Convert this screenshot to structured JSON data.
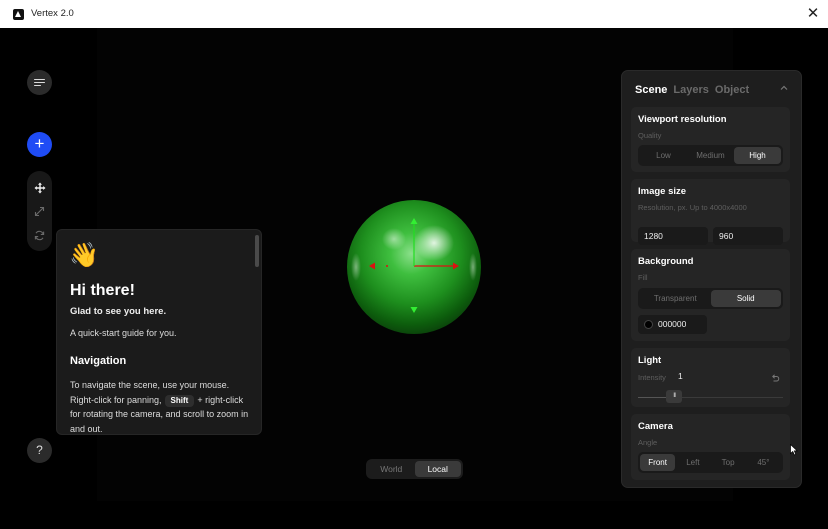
{
  "window": {
    "title": "Vertex 2.0",
    "close_glyph": "✕"
  },
  "toolbar": {
    "add_glyph": "+",
    "help_glyph": "?",
    "icons": [
      "menu-icon",
      "plus-icon",
      "move-icon",
      "scale-icon",
      "rotate-icon",
      "help-icon"
    ]
  },
  "welcome": {
    "emoji": "👋",
    "title": "Hi there!",
    "subtitle": "Glad to see you here.",
    "guide": "A quick-start guide for you.",
    "nav_heading": "Navigation",
    "nav_text_1": "To navigate the scene, use your mouse. Right-click for panning,",
    "nav_key": "Shift",
    "nav_text_2": "+ right-click for rotating the camera, and scroll to zoom in and out."
  },
  "viewport": {
    "sphere_color": "#2fae2f",
    "space_toggle": {
      "options": [
        "World",
        "Local"
      ],
      "selected": "Local"
    }
  },
  "panel": {
    "tabs": [
      {
        "label": "Scene",
        "active": true
      },
      {
        "label": "Layers",
        "active": false
      },
      {
        "label": "Object",
        "active": false
      }
    ],
    "viewport_resolution": {
      "title": "Viewport resolution",
      "quality_label": "Quality",
      "options": [
        "Low",
        "Medium",
        "High"
      ],
      "selected": "High"
    },
    "image_size": {
      "title": "Image size",
      "hint": "Resolution, px. Up to 4000x4000",
      "width": "1280",
      "height": "960"
    },
    "background": {
      "title": "Background",
      "fill_label": "Fill",
      "options": [
        "Transparent",
        "Solid"
      ],
      "selected": "Solid",
      "color": "000000"
    },
    "light": {
      "title": "Light",
      "intensity_label": "Intensity",
      "intensity": "1",
      "slider_fraction": 0.25,
      "thumb_glyph": "III"
    },
    "camera": {
      "title": "Camera",
      "angle_label": "Angle",
      "options": [
        "Front",
        "Left",
        "Top",
        "45°"
      ],
      "selected": "Front"
    }
  }
}
